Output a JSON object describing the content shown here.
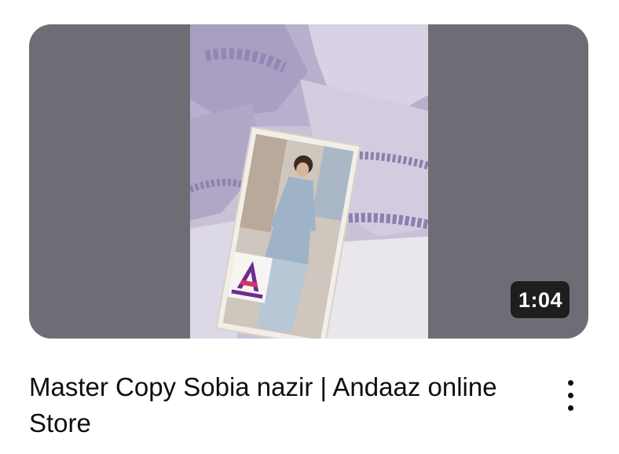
{
  "video": {
    "duration": "1:04",
    "title": "Master Copy Sobia nazir | Andaaz online Store"
  },
  "icons": {
    "more": "more-vert-icon",
    "logo": "andaaz-logo-icon"
  },
  "colors": {
    "thumbnail_background": "#6e6d75",
    "badge_background": "#121212",
    "title_text": "#0f0f0f"
  }
}
